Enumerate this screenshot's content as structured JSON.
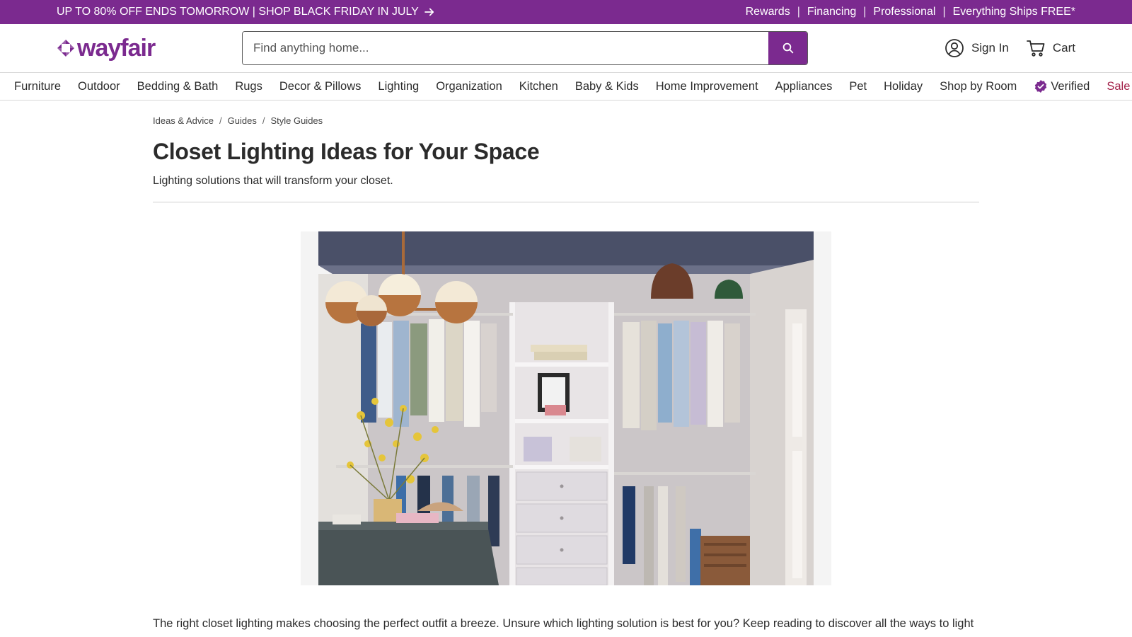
{
  "promo": {
    "headline": "UP TO 80% OFF ENDS TOMORROW | SHOP BLACK FRIDAY IN JULY",
    "links": [
      "Rewards",
      "Financing",
      "Professional",
      "Everything Ships FREE*"
    ]
  },
  "header": {
    "logo_text": "wayfair",
    "search_placeholder": "Find anything home...",
    "sign_in_label": "Sign In",
    "cart_label": "Cart"
  },
  "nav": {
    "items": [
      "Furniture",
      "Outdoor",
      "Bedding & Bath",
      "Rugs",
      "Decor & Pillows",
      "Lighting",
      "Organization",
      "Kitchen",
      "Baby & Kids",
      "Home Improvement",
      "Appliances",
      "Pet",
      "Holiday",
      "Shop by Room",
      "Verified",
      "Sale"
    ]
  },
  "breadcrumb": [
    "Ideas & Advice",
    "Guides",
    "Style Guides"
  ],
  "article": {
    "title": "Closet Lighting Ideas for Your Space",
    "subtitle": "Lighting solutions that will transform your closet.",
    "intro": "The right closet lighting makes choosing the perfect outfit a breeze. Unsure which lighting solution is best for you? Keep reading to discover all the ways to light up your wardrobe."
  },
  "colors": {
    "brand": "#7b2a8f",
    "sale": "#a3224a"
  },
  "icons": {
    "promo_arrow": "arrow-right-icon",
    "search": "search-icon",
    "account": "user-circle-icon",
    "cart": "cart-icon",
    "verified": "verified-badge-icon"
  }
}
